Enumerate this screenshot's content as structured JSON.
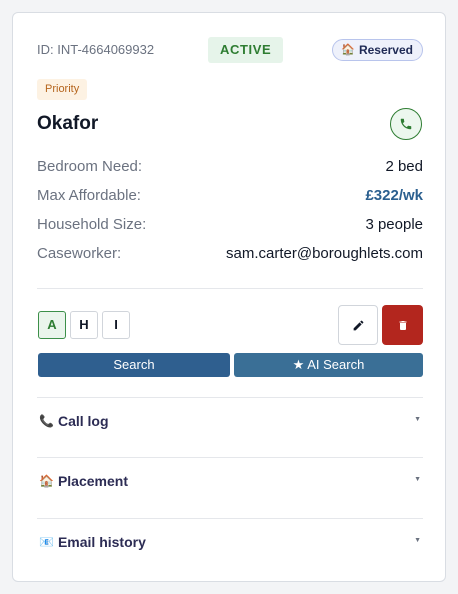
{
  "header": {
    "case_id": "ID: INT-4664069932",
    "status": "ACTIVE",
    "reserved": "Reserved",
    "reserved_icon": "🏠"
  },
  "priority_tag": "Priority",
  "applicant_name": "Okafor",
  "details": [
    {
      "label": "Bedroom Need:",
      "value": "2 bed"
    },
    {
      "label": "Max Affordable:",
      "value": "£322/wk"
    },
    {
      "label": "Household Size:",
      "value": "3 people"
    },
    {
      "label": "Caseworker:",
      "value": "sam.carter@boroughlets.com"
    }
  ],
  "letter_buttons": [
    "A",
    "H",
    "I"
  ],
  "actions": {
    "search_label": "Search",
    "ai_search_label": "AI Search",
    "ai_search_icon": "★"
  },
  "sections": [
    {
      "icon": "📞",
      "label": "Call log",
      "caret": "▼"
    },
    {
      "icon": "🏠",
      "label": "Placement",
      "caret": "▼"
    },
    {
      "icon": "📧",
      "label": "Email history",
      "caret": "▼"
    }
  ],
  "colors": {
    "status_green": "#2e7d32",
    "accent_blue": "#2b5f8f",
    "delete_red": "#b3261e",
    "priority_orange": "#b5651d"
  }
}
